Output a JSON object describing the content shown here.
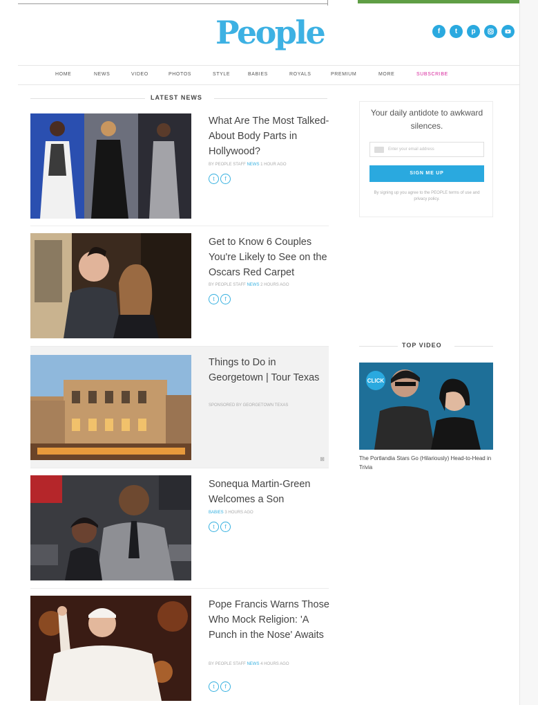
{
  "site": {
    "logo": "People",
    "social_icons": [
      "facebook-icon",
      "twitter-icon",
      "pinterest-icon",
      "instagram-icon",
      "youtube-icon"
    ]
  },
  "nav": {
    "items": [
      "HOME",
      "NEWS",
      "VIDEO",
      "PHOTOS",
      "STYLE",
      "BABIES",
      "ROYALS",
      "PREMIUM",
      "MORE",
      "SUBSCRIBE"
    ]
  },
  "latest_news": {
    "heading": "LATEST NEWS",
    "articles": [
      {
        "headline": "What Are The Most Talked-About Body Parts in Hollywood?",
        "byline_a": "BY PEOPLE STAFF",
        "byline_tag": "NEWS",
        "byline_b": "1 HOUR AGO"
      },
      {
        "headline": "Get to Know 6 Couples You're Likely to See on the Oscars Red Carpet",
        "byline_a": "BY PEOPLE STAFF",
        "byline_tag": "NEWS",
        "byline_b": "2 HOURS AGO"
      },
      {
        "headline": "Things to Do in Georgetown | Tour Texas",
        "byline_a": "SPONSORED BY GEORGETOWN TEXAS",
        "byline_tag": "",
        "byline_b": ""
      },
      {
        "headline": "Sonequa Martin-Green Welcomes a Son",
        "byline_a": "",
        "byline_tag": "BABIES",
        "byline_b": "3 HOURS AGO"
      },
      {
        "headline": "Pope Francis Warns Those Who Mock Religion: 'A Punch in the Nose' Awaits",
        "byline_a": "BY PEOPLE STAFF",
        "byline_tag": "NEWS",
        "byline_b": "4 HOURS AGO"
      }
    ],
    "ad_marker": "⊠"
  },
  "newsletter": {
    "tagline": "Your daily antidote to awkward silences.",
    "email_placeholder": "Enter your email address",
    "button_label": "SIGN ME UP",
    "fine_print": "By signing up you agree to the PEOPLE terms of use and privacy policy."
  },
  "top_video": {
    "heading": "TOP VIDEO",
    "badge": "CLICK",
    "caption": "The Portlandia Stars Go (Hilariously) Head-to-Head in Trivia"
  },
  "colors": {
    "brand": "#3db1e3",
    "accent_green": "#5f9e45",
    "subscribe": "#d7269c"
  }
}
